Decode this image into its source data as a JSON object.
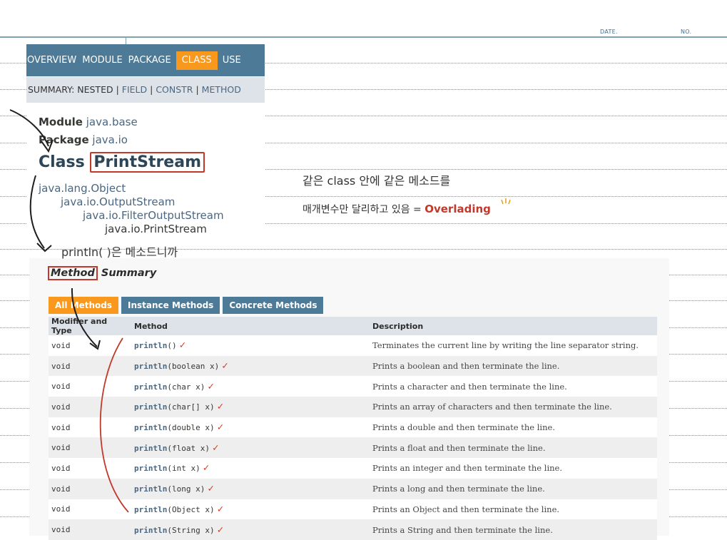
{
  "paper": {
    "date_label": "DATE.",
    "no_label": "NO."
  },
  "topnav": {
    "items": [
      "OVERVIEW",
      "MODULE",
      "PACKAGE",
      "CLASS",
      "USE"
    ],
    "active": "CLASS"
  },
  "subnav": {
    "prefix": "SUMMARY: NESTED | ",
    "field": "FIELD",
    "sep1": " | ",
    "constr": "CONSTR",
    "sep2": " | ",
    "method": "METHOD"
  },
  "header": {
    "module_label": "Module",
    "module_value": "java.base",
    "package_label": "Package",
    "package_value": "java.io",
    "class_label": "Class",
    "class_name": "PrintStream"
  },
  "inheritance": [
    "java.lang.Object",
    "java.io.OutputStream",
    "java.io.FilterOutputStream",
    "java.io.PrintStream"
  ],
  "summary": {
    "title_boxed": "Method",
    "title_rest": " Summary",
    "tabs": [
      "All Methods",
      "Instance Methods",
      "Concrete Methods"
    ],
    "columns": [
      "Modifier and Type",
      "Method",
      "Description"
    ],
    "rows": [
      {
        "type": "void",
        "name": "println",
        "params": "()",
        "desc": "Terminates the current line by writing the line separator string."
      },
      {
        "type": "void",
        "name": "println",
        "params": "(boolean x)",
        "desc": "Prints a boolean and then terminate the line."
      },
      {
        "type": "void",
        "name": "println",
        "params": "(char x)",
        "desc": "Prints a character and then terminate the line."
      },
      {
        "type": "void",
        "name": "println",
        "params": "(char[] x)",
        "desc": "Prints an array of characters and then terminate the line."
      },
      {
        "type": "void",
        "name": "println",
        "params": "(double x)",
        "desc": "Prints a double and then terminate the line."
      },
      {
        "type": "void",
        "name": "println",
        "params": "(float x)",
        "desc": "Prints a float and then terminate the line."
      },
      {
        "type": "void",
        "name": "println",
        "params": "(int x)",
        "desc": "Prints an integer and then terminate the line."
      },
      {
        "type": "void",
        "name": "println",
        "params": "(long x)",
        "desc": "Prints a long and then terminate the line."
      },
      {
        "type": "void",
        "name": "println",
        "params": "(Object x)",
        "desc": "Prints an Object and then terminate the line."
      },
      {
        "type": "void",
        "name": "println",
        "params": "(String x)",
        "desc": "Prints a String and then terminate the line."
      }
    ]
  },
  "annotations": {
    "note1": "같은 class 안에 같은 메소드를",
    "note2_a": "매개변수만 달리하고 있음 = ",
    "note2_b": "Overlading",
    "note3": "println( )은 메소드니까",
    "checkmark": "✓"
  },
  "colors": {
    "nav_bg": "#4d7a97",
    "nav_active": "#f8981d",
    "subnav_bg": "#dee3e9",
    "link": "#4a6782",
    "ink_red": "#c0392b",
    "paper_rule": "#7fa3ad"
  }
}
